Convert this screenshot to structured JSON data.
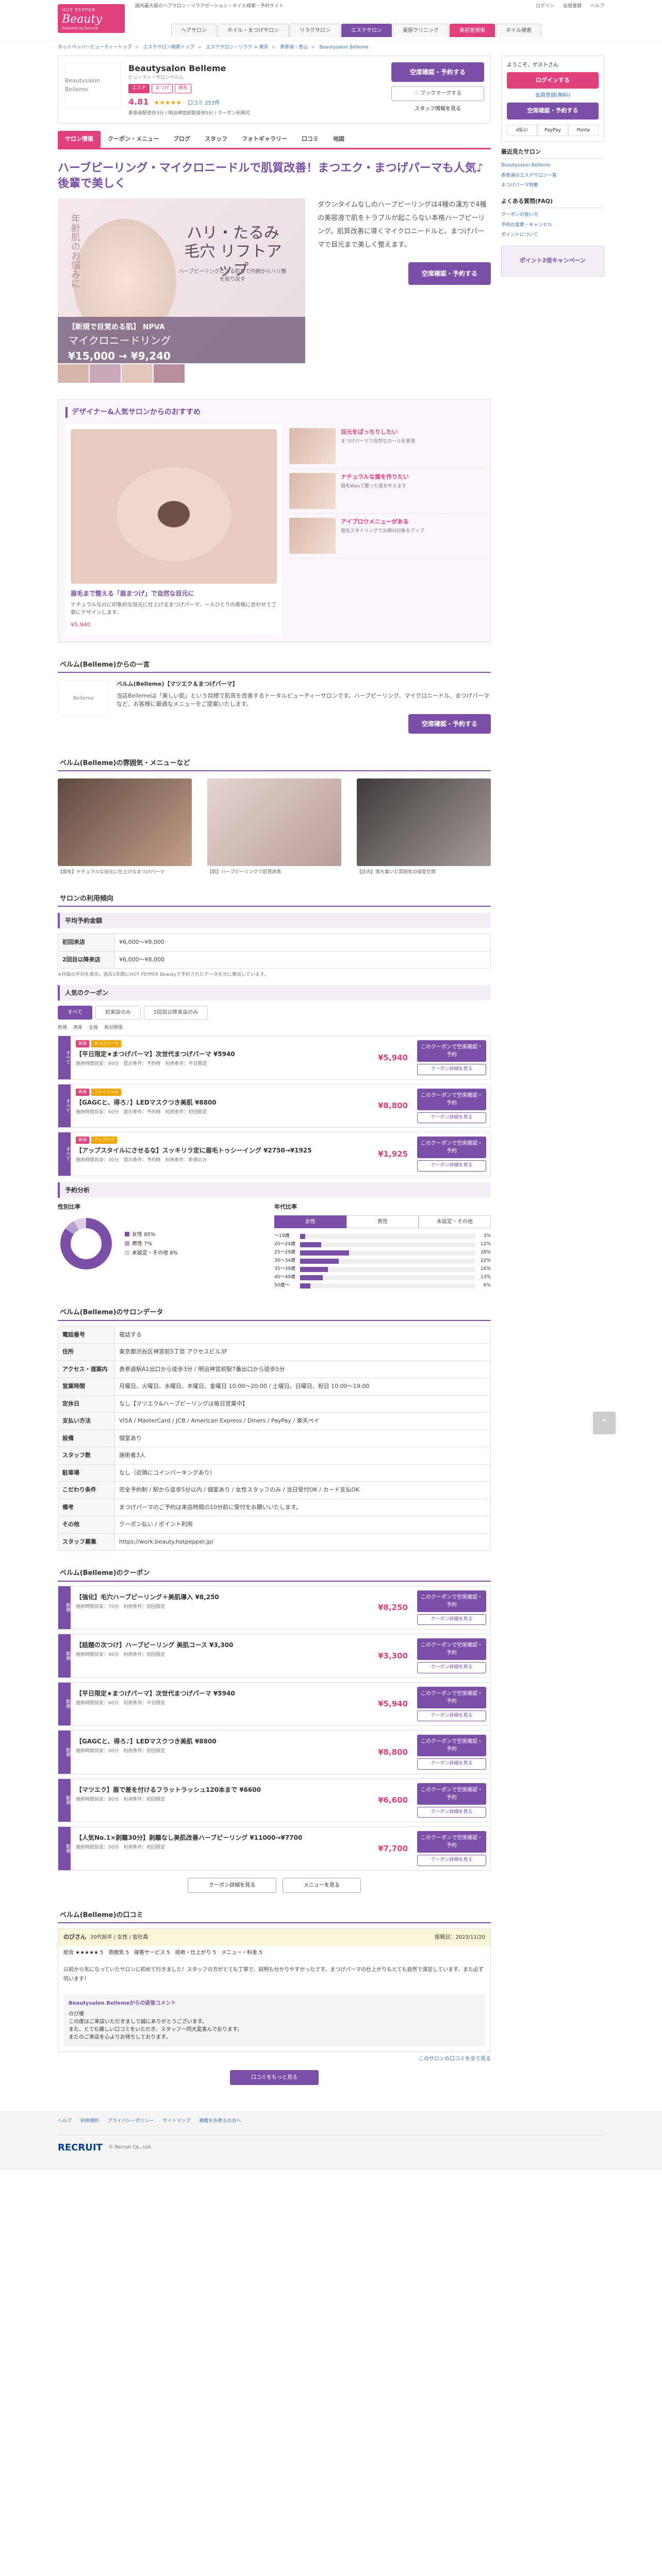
{
  "header": {
    "logo_small": "HOT PEPPER",
    "logo_big": "Beauty",
    "logo_sub": "Powered by Recruit",
    "top_links": [
      "国内最大級のヘアサロン・リラクゼーション・ネイル検索・予約サイト"
    ],
    "top_right_links": [
      "ログイン",
      "会員登録",
      "ヘルプ"
    ],
    "nav": [
      "ヘアサロン",
      "ネイル・まつげサロン",
      "リラクサロン",
      "エステサロン",
      "美容クリニック",
      "美容室検索",
      "ネイル検索"
    ],
    "nav_active_index": 3
  },
  "breadcrumb": [
    "ホットペッパービューティートップ",
    "エステサロン検索トップ",
    "エステサロン・リラク > 東京",
    "表参道・青山",
    "Beautysalon Belleme"
  ],
  "salon": {
    "logo_text": "Beautysalon Belleme",
    "name": "Beautysalon Belleme",
    "kana": "ビューティーサロンベルム",
    "tags": [
      "エステ",
      "まつげ",
      "脱毛"
    ],
    "rating": "4.81",
    "stars": "★★★★★",
    "review_count": "口コミ 253件",
    "address": "表参道駅徒歩3分 / 明治神宮前駅徒歩5分 / クーポン利用可",
    "reserve_btn": "空席確認・予約する",
    "fav_btn": "ブックマークする",
    "staff_btn": "スタッフ情報を見る"
  },
  "tabs": [
    "サロン情報",
    "クーポン・メニュー",
    "ブログ",
    "スタッフ",
    "フォトギャラリー",
    "口コミ",
    "地図"
  ],
  "catch": "ハーブピーリング・マイクロニードルで肌質改善！まつエク・まつげパーマも人気♪後輩で美しく",
  "hero": {
    "vtext": "年齢肌のお悩みに",
    "h1": "ハリ・たるみ毛穴 リフトアップ",
    "h2": "ハーブピーリングによる肌育で内側からハリ艶を取り戻す",
    "band_1": "【新規で目覚める肌】 NPVA",
    "band_2": "マイクロニードリング",
    "band_3": "¥15,000 → ¥9,240",
    "text": "ダウンタイムなしのハーブピーリングは4種の漢方で4種の美容液で肌をトラブルが起こらない本格ハーブピーリング。肌質改善に導くマイクロニードルと、まつげパーマで目元まで美しく整えます。",
    "reserve_btn": "空席確認・予約する"
  },
  "points": {
    "title": "デザイナー&人気サロンからのおすすめ",
    "left_caption": "眉毛まで整える「眉まつげ」で自然な目元に",
    "left_desc": "ナチュラルなのに印象的な目元に仕上げるまつげパーマ。一人ひとりの骨格に合わせて丁寧にデザインします。",
    "price": "¥5,940",
    "items": [
      {
        "title": "目元をぱっちりしたい",
        "desc": "まつげパーマで自然なカールを実現"
      },
      {
        "title": "ナチュラルな眉を作りたい",
        "desc": "眉毛Waxで整った眉を叶えます"
      },
      {
        "title": "アイブロウメニューがある",
        "desc": "眉毛スタイリングでお顔の印象をアップ"
      }
    ]
  },
  "message": {
    "title": "ベルム(Belleme)からの一言",
    "logo_text": "Belleme",
    "heading": "ベルム(Belleme)【マツエク＆まつげパーマ】",
    "body": "当店Bellemeは「美しい肌」という目標で肌質を改善するトータルビューティーサロンです。ハーブピーリング、マイクロニードル、まつげパーマなど、お客様に最適なメニューをご提案いたします。",
    "reserve_btn": "空席確認・予約する"
  },
  "gallery": {
    "title": "ベルム(Belleme)の雰囲気・メニューなど",
    "items": [
      {
        "cap": "【眉毛】ナチュラルな目元に仕上げるまつげパーマ"
      },
      {
        "cap": "【肌】ハーブピーリングで肌質改善"
      },
      {
        "cap": "【店内】落ち着いた雰囲気の個室空間"
      }
    ]
  },
  "usage": {
    "title": "サロンの利用傾向",
    "price_title": "平均予約金額",
    "rows": [
      {
        "label": "初回来店",
        "value": "¥6,000〜¥8,000"
      },
      {
        "label": "2回目以降来店",
        "value": "¥6,000〜¥8,000"
      }
    ],
    "note": "※月毎の平均を表示。過去1年間にHOT PEPPER Beautyで予約されたデータを元に算出しています。"
  },
  "coupons_popular": {
    "title": "人気のクーポン",
    "tabs": [
      "すべて",
      "初来店のみ",
      "2回目以降来店のみ"
    ],
    "legend": [
      "新規",
      "再来",
      "全員",
      "有効期限"
    ],
    "items": [
      {
        "badges": [
          "新規",
          "まつげパーマ"
        ],
        "title": "【平日限定★まつげパーマ】次世代まつげパーマ ¥5940",
        "desc": "施術時間目安：60分　提示条件：予約時　利用条件：平日限定",
        "price": "¥5,940"
      },
      {
        "badges": [
          "新規",
          "フェイシャル"
        ],
        "title": "【GAGCと、得ろ♪】LEDマスクつき美肌 ¥8800",
        "desc": "施術時間目安：60分　提示条件：予約時　利用条件：初回限定",
        "price": "¥8,800"
      },
      {
        "badges": [
          "新規",
          "アイブロウ"
        ],
        "title": "【アップスタイルにさせるな】スッキリラ定に眉毛トゥシーイング ¥2750→¥1925",
        "desc": "施術時間目安：30分　提示条件：予約時　利用条件：新規の方",
        "price": "¥1,925"
      }
    ],
    "btn_reserve": "このクーポンで空席確認・予約",
    "btn_more": "クーポン詳細を見る"
  },
  "reservation": {
    "title": "予約分析",
    "gender_title": "性別比率",
    "age_title": "年代比率",
    "age_tabs": [
      "女性",
      "男性",
      "未設定・その他"
    ],
    "gender": [
      {
        "label": "女性",
        "pct": 85,
        "color": "#7b4fa8"
      },
      {
        "label": "男性",
        "pct": 7,
        "color": "#b99fd0"
      },
      {
        "label": "未設定・その他",
        "pct": 8,
        "color": "#dcd0e8"
      }
    ],
    "ages": [
      {
        "label": "〜19歳",
        "pct": 3
      },
      {
        "label": "20〜24歳",
        "pct": 12
      },
      {
        "label": "25〜29歳",
        "pct": 28
      },
      {
        "label": "30〜34歳",
        "pct": 22
      },
      {
        "label": "35〜39歳",
        "pct": 16
      },
      {
        "label": "40〜49歳",
        "pct": 13
      },
      {
        "label": "50歳〜",
        "pct": 6
      }
    ]
  },
  "salon_data": {
    "title": "ベルム(Belleme)のサロンデータ",
    "rows": [
      {
        "label": "電話番号",
        "value": "電話する"
      },
      {
        "label": "住所",
        "value": "東京都渋谷区神宮前5丁目 アクセスビル3F"
      },
      {
        "label": "アクセス・道案内",
        "value": "表参道駅A1出口から徒歩3分 / 明治神宮前駅7番出口から徒歩5分"
      },
      {
        "label": "営業時間",
        "value": "月曜日、火曜日、水曜日、木曜日、金曜日 10:00〜20:00 / 土曜日、日曜日、祝日 10:00〜19:00"
      },
      {
        "label": "定休日",
        "value": "なし【マツエク&ハーブピーリングは毎日営業中】"
      },
      {
        "label": "支払い方法",
        "value": "VISA / MasterCard / JCB / American Express / Diners / PayPay / 楽天ペイ"
      },
      {
        "label": "設備",
        "value": "個室あり"
      },
      {
        "label": "スタッフ数",
        "value": "施術者3人"
      },
      {
        "label": "駐車場",
        "value": "なし（近隣にコインパーキングあり）"
      },
      {
        "label": "こだわり条件",
        "value": "完全予約制 / 駅から徒歩5分以内 / 個室あり / 女性スタッフのみ / 当日受付OK / カード支払OK"
      },
      {
        "label": "備考",
        "value": "まつげパーマのご予約は来店時間の10分前に受付をお願いいたします。"
      },
      {
        "label": "その他",
        "value": "クーポン払い / ポイント利用"
      },
      {
        "label": "スタッフ募集",
        "value": "https://work.beauty.hotpepper.jp/"
      }
    ]
  },
  "coupons_all": {
    "title": "ベルム(Belleme)のクーポン",
    "items": [
      {
        "side": "新規",
        "title": "【強化】毛穴ハーブピーリング＋美肌導入 ¥8,250",
        "desc": "施術時間目安：70分　利用条件：初回限定",
        "price": "¥8,250"
      },
      {
        "side": "新規",
        "title": "【話題の次つけ】ハーブピーリング 美肌コース ¥3,300",
        "desc": "施術時間目安：40分　利用条件：初回限定",
        "price": "¥3,300"
      },
      {
        "side": "新規",
        "title": "【平日限定★まつげパーマ】次世代まつげパーマ ¥5940",
        "desc": "施術時間目安：60分　利用条件：平日限定",
        "price": "¥5,940"
      },
      {
        "side": "新規",
        "title": "【GAGCと、得ろ♪】LEDマスクつき美肌 ¥8800",
        "desc": "施術時間目安：60分　利用条件：初回限定",
        "price": "¥8,800"
      },
      {
        "side": "新規",
        "title": "【マツエク】眉で差を付けるフラットラッシュ120本まで ¥6600",
        "desc": "施術時間目安：80分　利用条件：初回限定",
        "price": "¥6,600"
      },
      {
        "side": "新規",
        "title": "【人気No.1×剥離30分】剥離なし美肌改善ハーブピーリング ¥11000→¥7700",
        "desc": "施術時間目安：90分　利用条件：初回限定",
        "price": "¥7,700"
      }
    ],
    "more": "クーポン詳細を見る",
    "menu": "メニューを見る"
  },
  "reviews": {
    "title": "ベルム(Belleme)の口コミ",
    "user": "のびさん",
    "meta": "20代前半 / 女性 / 会社員",
    "date": "投稿日：2023/11/20",
    "stars": "総合 ★★★★★ 5　雰囲気 5　接客サービス 5　技術・仕上がり 5　メニュー・料金 5",
    "body": "以前から気になっていたサロンに初めて行きました！スタッフの方がとても丁寧で、説明も分かりやすかったです。まつげパーマの仕上がりもとても自然で満足しています。また必ず伺います！",
    "reply_title": "Beautysalon Bellemeからの返信コメント",
    "reply_body": "のび様\nこの度はご来店いただきまして誠にありがとうございます。\nまた、とても嬉しい口コミをいただき、スタッフ一同大変喜んでおります。\nまたのご来店を心よりお待ちしております。",
    "more_btn": "口コミをもっと見る",
    "more_link": "このサロンの口コミを全て見る"
  },
  "sidebar": {
    "welcome": "ようこそ、ゲストさん",
    "login": "ログインする",
    "register": "会員登録(無料)",
    "reserve_btn": "空席確認・予約する",
    "history_title": "最近見たサロン",
    "history": [
      "Beautysalon Belleme",
      "表参道のエステサロン一覧",
      "まつげパーマ特集"
    ],
    "ranking_title": "よくある質問(FAQ)",
    "faq": [
      "クーポンの使い方",
      "予約の変更・キャンセル",
      "ポイントについて"
    ],
    "banner": "ポイント2倍キャンペーン",
    "pay": [
      "d払い",
      "PayPay",
      "Ponta"
    ]
  },
  "footer": {
    "links": [
      "ヘルプ",
      "利用規約",
      "プライバシーポリシー",
      "サイトマップ",
      "掲載をお考えの方へ"
    ],
    "copyright": "© Recruit Co., Ltd."
  }
}
